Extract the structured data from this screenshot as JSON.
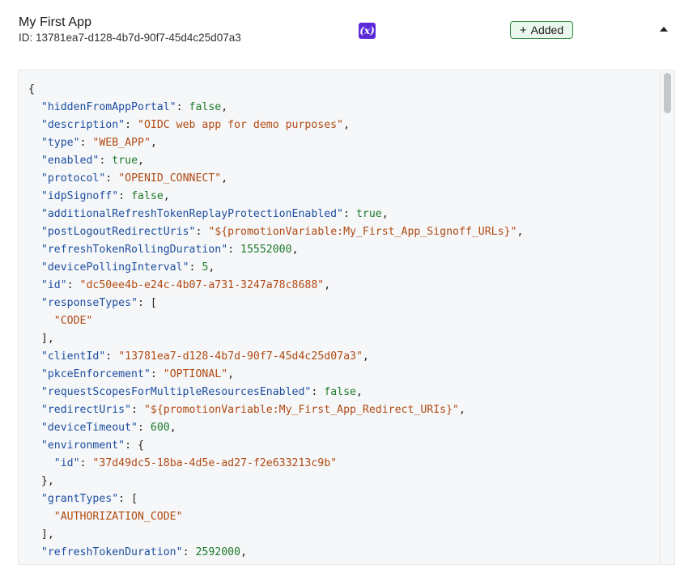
{
  "header": {
    "title": "My First App",
    "id_text": "ID: 13781ea7-d128-4b7d-90f7-45d4c25d07a3",
    "variable_icon_label": "(x)",
    "added_button": {
      "plus": "+",
      "label": "Added"
    },
    "collapse_icon": "caret-up-icon"
  },
  "code_lines": [
    [
      {
        "t": "p",
        "v": "{"
      }
    ],
    [
      {
        "t": "p",
        "v": "  "
      },
      {
        "t": "k",
        "v": "\"hiddenFromAppPortal\""
      },
      {
        "t": "p",
        "v": ": "
      },
      {
        "t": "b",
        "v": "false"
      },
      {
        "t": "p",
        "v": ","
      }
    ],
    [
      {
        "t": "p",
        "v": "  "
      },
      {
        "t": "k",
        "v": "\"description\""
      },
      {
        "t": "p",
        "v": ": "
      },
      {
        "t": "s",
        "v": "\"OIDC web app for demo purposes\""
      },
      {
        "t": "p",
        "v": ","
      }
    ],
    [
      {
        "t": "p",
        "v": "  "
      },
      {
        "t": "k",
        "v": "\"type\""
      },
      {
        "t": "p",
        "v": ": "
      },
      {
        "t": "s",
        "v": "\"WEB_APP\""
      },
      {
        "t": "p",
        "v": ","
      }
    ],
    [
      {
        "t": "p",
        "v": "  "
      },
      {
        "t": "k",
        "v": "\"enabled\""
      },
      {
        "t": "p",
        "v": ": "
      },
      {
        "t": "b",
        "v": "true"
      },
      {
        "t": "p",
        "v": ","
      }
    ],
    [
      {
        "t": "p",
        "v": "  "
      },
      {
        "t": "k",
        "v": "\"protocol\""
      },
      {
        "t": "p",
        "v": ": "
      },
      {
        "t": "s",
        "v": "\"OPENID_CONNECT\""
      },
      {
        "t": "p",
        "v": ","
      }
    ],
    [
      {
        "t": "p",
        "v": "  "
      },
      {
        "t": "k",
        "v": "\"idpSignoff\""
      },
      {
        "t": "p",
        "v": ": "
      },
      {
        "t": "b",
        "v": "false"
      },
      {
        "t": "p",
        "v": ","
      }
    ],
    [
      {
        "t": "p",
        "v": "  "
      },
      {
        "t": "k",
        "v": "\"additionalRefreshTokenReplayProtectionEnabled\""
      },
      {
        "t": "p",
        "v": ": "
      },
      {
        "t": "b",
        "v": "true"
      },
      {
        "t": "p",
        "v": ","
      }
    ],
    [
      {
        "t": "p",
        "v": "  "
      },
      {
        "t": "k",
        "v": "\"postLogoutRedirectUris\""
      },
      {
        "t": "p",
        "v": ": "
      },
      {
        "t": "s",
        "v": "\"${promotionVariable:My_First_App_Signoff_URLs}\""
      },
      {
        "t": "p",
        "v": ","
      }
    ],
    [
      {
        "t": "p",
        "v": "  "
      },
      {
        "t": "k",
        "v": "\"refreshTokenRollingDuration\""
      },
      {
        "t": "p",
        "v": ": "
      },
      {
        "t": "n",
        "v": "15552000"
      },
      {
        "t": "p",
        "v": ","
      }
    ],
    [
      {
        "t": "p",
        "v": "  "
      },
      {
        "t": "k",
        "v": "\"devicePollingInterval\""
      },
      {
        "t": "p",
        "v": ": "
      },
      {
        "t": "n",
        "v": "5"
      },
      {
        "t": "p",
        "v": ","
      }
    ],
    [
      {
        "t": "p",
        "v": "  "
      },
      {
        "t": "k",
        "v": "\"id\""
      },
      {
        "t": "p",
        "v": ": "
      },
      {
        "t": "s",
        "v": "\"dc50ee4b-e24c-4b07-a731-3247a78c8688\""
      },
      {
        "t": "p",
        "v": ","
      }
    ],
    [
      {
        "t": "p",
        "v": "  "
      },
      {
        "t": "k",
        "v": "\"responseTypes\""
      },
      {
        "t": "p",
        "v": ": ["
      }
    ],
    [
      {
        "t": "p",
        "v": "    "
      },
      {
        "t": "s",
        "v": "\"CODE\""
      }
    ],
    [
      {
        "t": "p",
        "v": "  ],"
      }
    ],
    [
      {
        "t": "p",
        "v": "  "
      },
      {
        "t": "k",
        "v": "\"clientId\""
      },
      {
        "t": "p",
        "v": ": "
      },
      {
        "t": "s",
        "v": "\"13781ea7-d128-4b7d-90f7-45d4c25d07a3\""
      },
      {
        "t": "p",
        "v": ","
      }
    ],
    [
      {
        "t": "p",
        "v": "  "
      },
      {
        "t": "k",
        "v": "\"pkceEnforcement\""
      },
      {
        "t": "p",
        "v": ": "
      },
      {
        "t": "s",
        "v": "\"OPTIONAL\""
      },
      {
        "t": "p",
        "v": ","
      }
    ],
    [
      {
        "t": "p",
        "v": "  "
      },
      {
        "t": "k",
        "v": "\"requestScopesForMultipleResourcesEnabled\""
      },
      {
        "t": "p",
        "v": ": "
      },
      {
        "t": "b",
        "v": "false"
      },
      {
        "t": "p",
        "v": ","
      }
    ],
    [
      {
        "t": "p",
        "v": "  "
      },
      {
        "t": "k",
        "v": "\"redirectUris\""
      },
      {
        "t": "p",
        "v": ": "
      },
      {
        "t": "s",
        "v": "\"${promotionVariable:My_First_App_Redirect_URIs}\""
      },
      {
        "t": "p",
        "v": ","
      }
    ],
    [
      {
        "t": "p",
        "v": "  "
      },
      {
        "t": "k",
        "v": "\"deviceTimeout\""
      },
      {
        "t": "p",
        "v": ": "
      },
      {
        "t": "n",
        "v": "600"
      },
      {
        "t": "p",
        "v": ","
      }
    ],
    [
      {
        "t": "p",
        "v": "  "
      },
      {
        "t": "k",
        "v": "\"environment\""
      },
      {
        "t": "p",
        "v": ": {"
      }
    ],
    [
      {
        "t": "p",
        "v": "    "
      },
      {
        "t": "k",
        "v": "\"id\""
      },
      {
        "t": "p",
        "v": ": "
      },
      {
        "t": "s",
        "v": "\"37d49dc5-18ba-4d5e-ad27-f2e633213c9b\""
      }
    ],
    [
      {
        "t": "p",
        "v": "  },"
      }
    ],
    [
      {
        "t": "p",
        "v": "  "
      },
      {
        "t": "k",
        "v": "\"grantTypes\""
      },
      {
        "t": "p",
        "v": ": ["
      }
    ],
    [
      {
        "t": "p",
        "v": "    "
      },
      {
        "t": "s",
        "v": "\"AUTHORIZATION_CODE\""
      }
    ],
    [
      {
        "t": "p",
        "v": "  ],"
      }
    ],
    [
      {
        "t": "p",
        "v": "  "
      },
      {
        "t": "k",
        "v": "\"refreshTokenDuration\""
      },
      {
        "t": "p",
        "v": ": "
      },
      {
        "t": "n",
        "v": "2592000"
      },
      {
        "t": "p",
        "v": ","
      }
    ]
  ],
  "colors": {
    "key": "#1c4fa0",
    "string": "#b04a12",
    "number": "#1c7a2a",
    "boolean": "#1c7a2a",
    "variable_icon_bg": "#5b2bd9",
    "added_border": "#2e8b3d",
    "added_bg": "#e9f7ec",
    "panel_bg": "#f6f7f9"
  }
}
